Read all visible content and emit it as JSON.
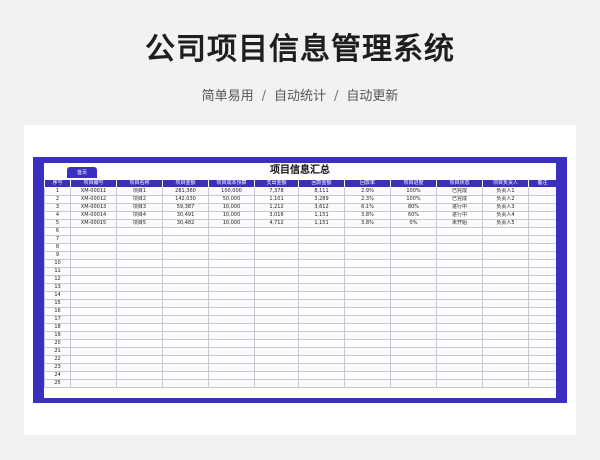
{
  "header": {
    "title": "公司项目信息管理系统",
    "tagline": [
      "简单易用",
      "自动统计",
      "自动更新"
    ],
    "separator": "/"
  },
  "sheet": {
    "home_label": "首页",
    "title": "项目信息汇总",
    "columns": [
      "序号",
      "项目编号",
      "项目名称",
      "项目金额",
      "项目成本预算",
      "支出金额",
      "回款金额",
      "回款率",
      "项目进度",
      "项目状态",
      "项目负责人",
      "备注"
    ],
    "rows": [
      [
        "1",
        "XM-00011",
        "项目1",
        "281,360",
        "100,000",
        "7,378",
        "8,111",
        "2.9%",
        "100%",
        "已完成",
        "负责人1",
        ""
      ],
      [
        "2",
        "XM-00012",
        "项目2",
        "142,030",
        "50,000",
        "1,101",
        "3,289",
        "2.3%",
        "100%",
        "已完成",
        "负责人2",
        ""
      ],
      [
        "3",
        "XM-00013",
        "项目3",
        "59,387",
        "10,000",
        "1,212",
        "3,612",
        "6.1%",
        "80%",
        "进行中",
        "负责人3",
        ""
      ],
      [
        "4",
        "XM-00014",
        "项目4",
        "30,491",
        "10,000",
        "3,016",
        "1,151",
        "3.8%",
        "60%",
        "进行中",
        "负责人4",
        ""
      ],
      [
        "5",
        "XM-00015",
        "项目5",
        "30,482",
        "10,000",
        "4,712",
        "1,151",
        "3.8%",
        "0%",
        "未开始",
        "负责人5",
        ""
      ],
      [
        "6",
        "",
        "",
        "",
        "",
        "",
        "",
        "",
        "",
        "",
        "",
        ""
      ],
      [
        "7",
        "",
        "",
        "",
        "",
        "",
        "",
        "",
        "",
        "",
        "",
        ""
      ],
      [
        "8",
        "",
        "",
        "",
        "",
        "",
        "",
        "",
        "",
        "",
        "",
        ""
      ],
      [
        "9",
        "",
        "",
        "",
        "",
        "",
        "",
        "",
        "",
        "",
        "",
        ""
      ],
      [
        "10",
        "",
        "",
        "",
        "",
        "",
        "",
        "",
        "",
        "",
        "",
        ""
      ],
      [
        "11",
        "",
        "",
        "",
        "",
        "",
        "",
        "",
        "",
        "",
        "",
        ""
      ],
      [
        "12",
        "",
        "",
        "",
        "",
        "",
        "",
        "",
        "",
        "",
        "",
        ""
      ],
      [
        "13",
        "",
        "",
        "",
        "",
        "",
        "",
        "",
        "",
        "",
        "",
        ""
      ],
      [
        "14",
        "",
        "",
        "",
        "",
        "",
        "",
        "",
        "",
        "",
        "",
        ""
      ],
      [
        "15",
        "",
        "",
        "",
        "",
        "",
        "",
        "",
        "",
        "",
        "",
        ""
      ],
      [
        "16",
        "",
        "",
        "",
        "",
        "",
        "",
        "",
        "",
        "",
        "",
        ""
      ],
      [
        "17",
        "",
        "",
        "",
        "",
        "",
        "",
        "",
        "",
        "",
        "",
        ""
      ],
      [
        "18",
        "",
        "",
        "",
        "",
        "",
        "",
        "",
        "",
        "",
        "",
        ""
      ],
      [
        "19",
        "",
        "",
        "",
        "",
        "",
        "",
        "",
        "",
        "",
        "",
        ""
      ],
      [
        "20",
        "",
        "",
        "",
        "",
        "",
        "",
        "",
        "",
        "",
        "",
        ""
      ],
      [
        "21",
        "",
        "",
        "",
        "",
        "",
        "",
        "",
        "",
        "",
        "",
        ""
      ],
      [
        "22",
        "",
        "",
        "",
        "",
        "",
        "",
        "",
        "",
        "",
        "",
        ""
      ],
      [
        "23",
        "",
        "",
        "",
        "",
        "",
        "",
        "",
        "",
        "",
        "",
        ""
      ],
      [
        "24",
        "",
        "",
        "",
        "",
        "",
        "",
        "",
        "",
        "",
        "",
        ""
      ],
      [
        "25",
        "",
        "",
        "",
        "",
        "",
        "",
        "",
        "",
        "",
        "",
        ""
      ]
    ]
  },
  "colors": {
    "accent": "#3a2fc0",
    "background": "#f1f2f4"
  }
}
